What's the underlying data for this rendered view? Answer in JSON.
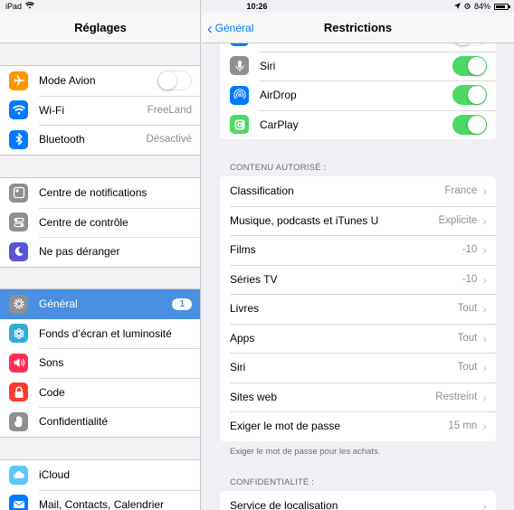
{
  "status": {
    "device": "iPad",
    "time": "10:26",
    "battery": "84%",
    "battery_level": 0.84
  },
  "left": {
    "title": "Réglages",
    "group1": [
      {
        "label": "Mode Avion",
        "icon": "airplane-icon",
        "color": "#ff9500",
        "toggle": false
      },
      {
        "label": "Wi-Fi",
        "icon": "wifi-icon",
        "color": "#007aff",
        "value": "FreeLand"
      },
      {
        "label": "Bluetooth",
        "icon": "bluetooth-icon",
        "color": "#007aff",
        "value": "Désactivé"
      }
    ],
    "group2": [
      {
        "label": "Centre de notifications",
        "icon": "notifications-icon",
        "color": "#8e8e93"
      },
      {
        "label": "Centre de contrôle",
        "icon": "control-center-icon",
        "color": "#8e8e93"
      },
      {
        "label": "Ne pas déranger",
        "icon": "moon-icon",
        "color": "#5856d6"
      }
    ],
    "group3": [
      {
        "label": "Général",
        "icon": "gear-icon",
        "color": "#8e8e93",
        "badge": "1",
        "selected": true
      },
      {
        "label": "Fonds d’écran et luminosité",
        "icon": "wallpaper-icon",
        "color": "#34aadc"
      },
      {
        "label": "Sons",
        "icon": "speaker-icon",
        "color": "#ff2d55"
      },
      {
        "label": "Code",
        "icon": "lock-icon",
        "color": "#ff3b30"
      },
      {
        "label": "Confidentialité",
        "icon": "hand-icon",
        "color": "#8e8e93"
      }
    ],
    "group4": [
      {
        "label": "iCloud",
        "icon": "cloud-icon",
        "color": "#5ac8fa"
      },
      {
        "label": "Mail, Contacts, Calendrier",
        "icon": "mail-icon",
        "color": "#007aff"
      }
    ]
  },
  "right": {
    "back_label": "Général",
    "title": "Restrictions",
    "top_items": [
      {
        "label": "Siri",
        "icon": "microphone-icon",
        "color": "#8e8e93",
        "toggle": true
      },
      {
        "label": "AirDrop",
        "icon": "airdrop-icon",
        "color": "#007aff",
        "toggle": true
      },
      {
        "label": "CarPlay",
        "icon": "carplay-icon",
        "color": "#4cd964",
        "toggle": true
      }
    ],
    "content_header": "CONTENU AUTORISÉ :",
    "content_items": [
      {
        "label": "Classification",
        "value": "France"
      },
      {
        "label": "Musique, podcasts et iTunes U",
        "value": "Explicite"
      },
      {
        "label": "Films",
        "value": "-10"
      },
      {
        "label": "Séries TV",
        "value": "-10"
      },
      {
        "label": "Livres",
        "value": "Tout"
      },
      {
        "label": "Apps",
        "value": "Tout"
      },
      {
        "label": "Siri",
        "value": "Tout"
      },
      {
        "label": "Sites web",
        "value": "Restreint"
      },
      {
        "label": "Exiger le mot de passe",
        "value": "15 mn"
      }
    ],
    "content_footer": "Exiger le mot de passe pour les achats.",
    "privacy_header": "CONFIDENTIALITÉ :",
    "privacy_items": [
      {
        "label": "Service de localisation",
        "value": ""
      }
    ]
  }
}
